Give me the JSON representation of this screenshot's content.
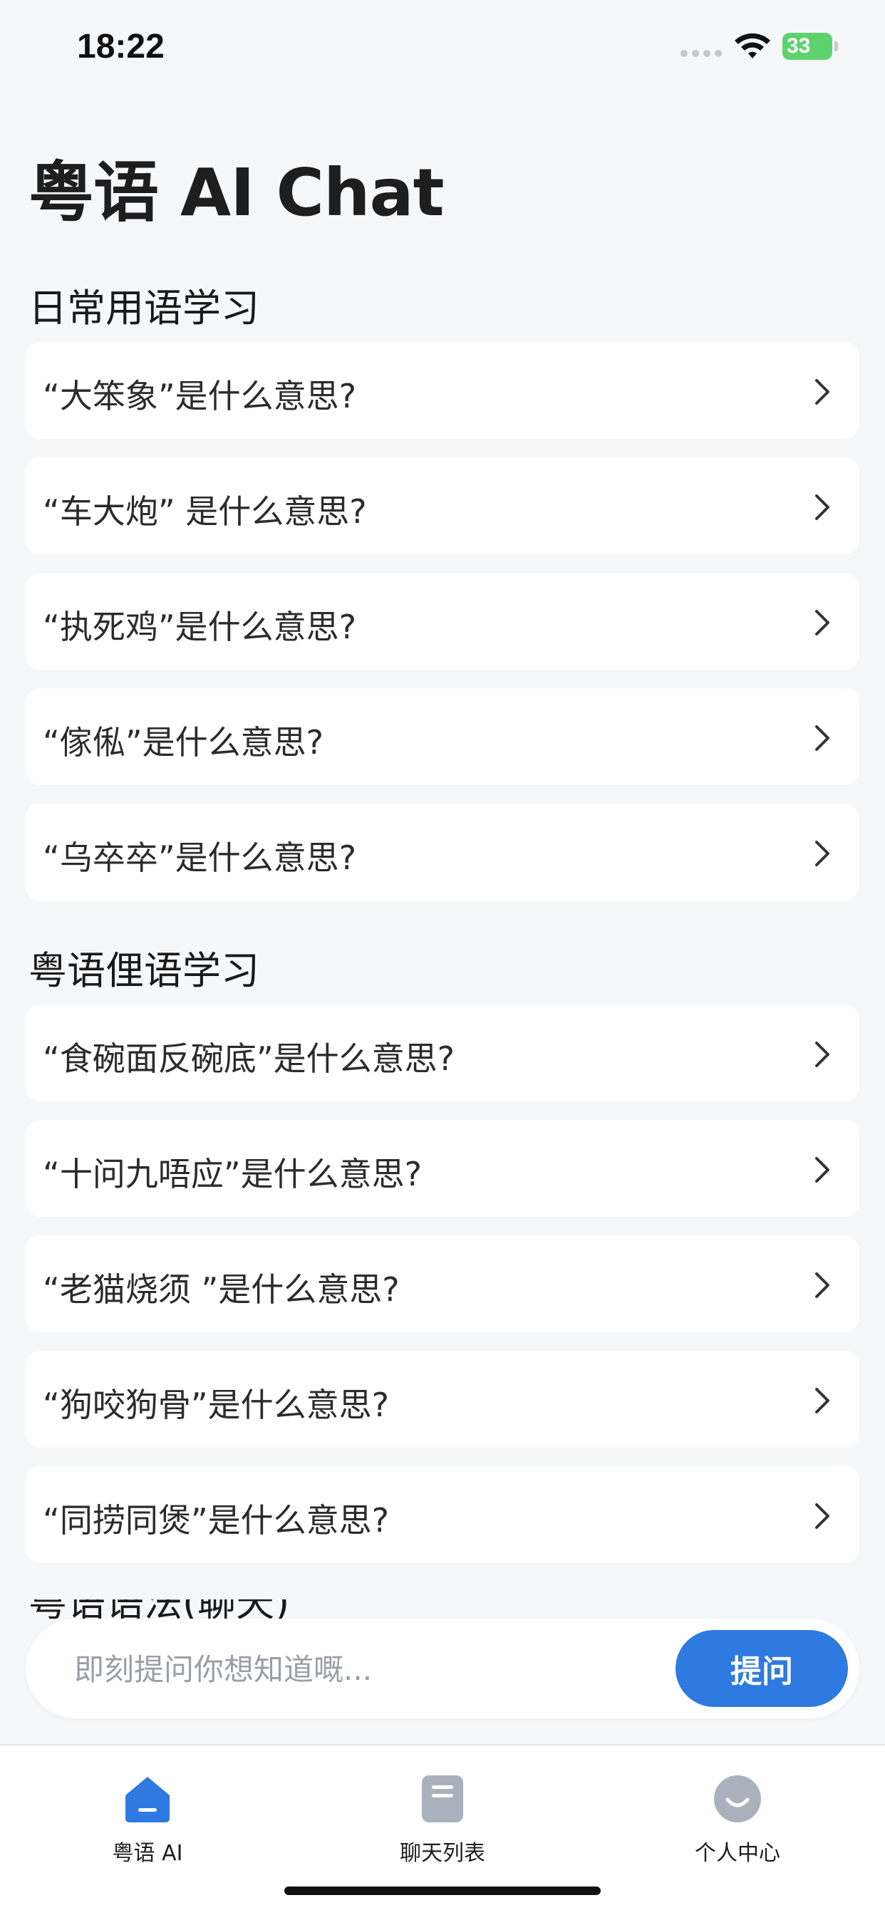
{
  "status_bar": {
    "time": "18:22",
    "battery": "33"
  },
  "header": {
    "title": "粤语 AI Chat"
  },
  "sections": [
    {
      "title": "日常用语学习",
      "items": [
        "“大笨象”是什么意思?",
        "“车大炮” 是什么意思?",
        "“执死鸡”是什么意思?",
        "“傢俬”是什么意思?",
        "“乌卒卒”是什么意思?"
      ]
    },
    {
      "title": "粤语俚语学习",
      "items": [
        "“食碗面反碗底”是什么意思?",
        "“十问九唔应”是什么意思?",
        "“老猫烧须 ”是什么意思?",
        "“狗咬狗骨”是什么意思?",
        "“同捞同煲”是什么意思?"
      ]
    }
  ],
  "next_section_peek": "粤语语法(聊天)",
  "ask_bar": {
    "placeholder": "即刻提问你想知道嘅...",
    "button_label": "提问"
  },
  "tab_bar": {
    "tabs": [
      {
        "label": "粤语 AI",
        "icon": "home-icon"
      },
      {
        "label": "聊天列表",
        "icon": "document-icon"
      },
      {
        "label": "个人中心",
        "icon": "profile-face-icon"
      }
    ]
  },
  "colors": {
    "accent": "#2f7ae0",
    "background": "#f6f7f9",
    "card": "#ffffff",
    "battery": "#5ed26d"
  }
}
